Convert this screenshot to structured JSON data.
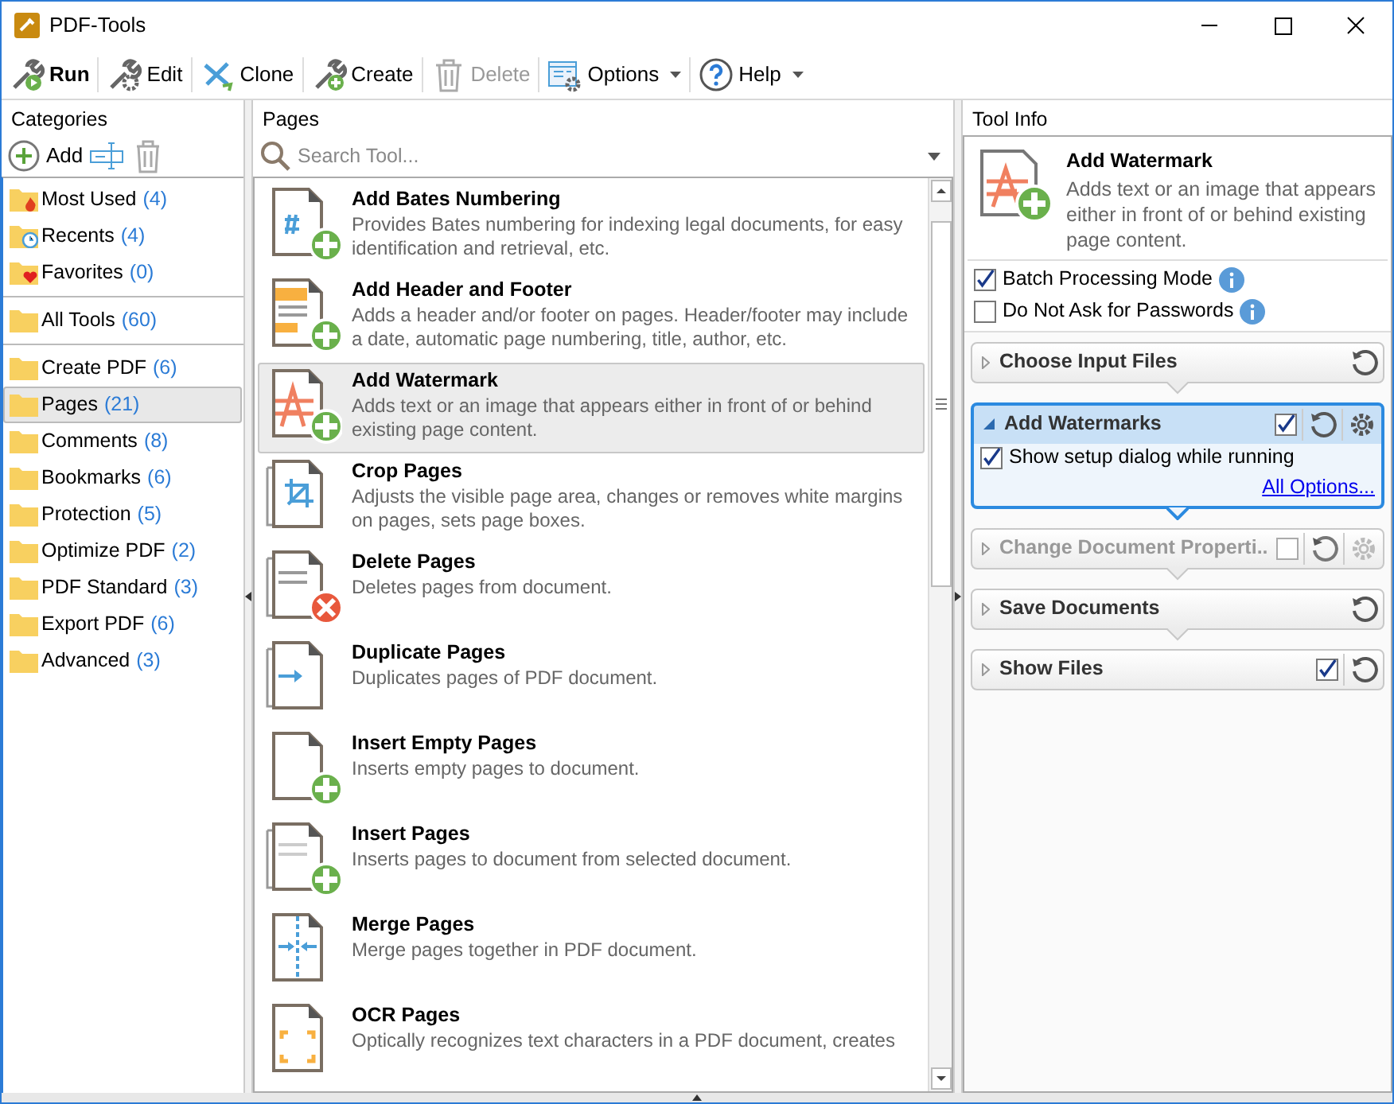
{
  "window": {
    "title": "PDF-Tools"
  },
  "toolbar": [
    {
      "label": "Run",
      "default": true,
      "disabled": false,
      "dropdown": false
    },
    {
      "label": "Edit",
      "default": false,
      "disabled": false,
      "dropdown": false
    },
    {
      "label": "Clone",
      "default": false,
      "disabled": false,
      "dropdown": false
    },
    {
      "label": "Create",
      "default": false,
      "disabled": false,
      "dropdown": false
    },
    {
      "label": "Delete",
      "default": false,
      "disabled": true,
      "dropdown": false
    },
    {
      "label": "Options",
      "default": false,
      "disabled": false,
      "dropdown": true
    },
    {
      "label": "Help",
      "default": false,
      "disabled": false,
      "dropdown": true
    }
  ],
  "categories": {
    "title": "Categories",
    "add_label": "Add",
    "groups": [
      [
        {
          "name": "Most Used",
          "count": "(4)",
          "selected": false
        },
        {
          "name": "Recents",
          "count": "(4)",
          "selected": false
        },
        {
          "name": "Favorites",
          "count": "(0)",
          "selected": false
        }
      ],
      [
        {
          "name": "All Tools",
          "count": "(60)",
          "selected": false
        }
      ],
      [
        {
          "name": "Create PDF",
          "count": "(6)",
          "selected": false
        },
        {
          "name": "Pages",
          "count": "(21)",
          "selected": true
        },
        {
          "name": "Comments",
          "count": "(8)",
          "selected": false
        },
        {
          "name": "Bookmarks",
          "count": "(6)",
          "selected": false
        },
        {
          "name": "Protection",
          "count": "(5)",
          "selected": false
        },
        {
          "name": "Optimize PDF",
          "count": "(2)",
          "selected": false
        },
        {
          "name": "PDF Standard",
          "count": "(3)",
          "selected": false
        },
        {
          "name": "Export PDF",
          "count": "(6)",
          "selected": false
        },
        {
          "name": "Advanced",
          "count": "(3)",
          "selected": false
        }
      ]
    ]
  },
  "pages": {
    "title": "Pages",
    "search": {
      "placeholder": "Search Tool..."
    },
    "tools": [
      {
        "name": "Add Bates Numbering",
        "description": "Provides Bates numbering for indexing legal documents, for easy identification and retrieval, etc.",
        "selected": false
      },
      {
        "name": "Add Header and Footer",
        "description": "Adds a header and/or footer on pages. Header/footer may include a date, automatic page numbering, title, author, etc.",
        "selected": false
      },
      {
        "name": "Add Watermark",
        "description": "Adds text or an image that appears either in front of or behind existing page content.",
        "selected": true
      },
      {
        "name": "Crop Pages",
        "description": "Adjusts the visible page area, changes or removes white margins on pages, sets page boxes.",
        "selected": false
      },
      {
        "name": "Delete Pages",
        "description": "Deletes pages from document.",
        "selected": false
      },
      {
        "name": "Duplicate Pages",
        "description": "Duplicates pages of PDF document.",
        "selected": false
      },
      {
        "name": "Insert Empty Pages",
        "description": "Inserts empty pages to document.",
        "selected": false
      },
      {
        "name": "Insert Pages",
        "description": "Inserts pages to document from selected document.",
        "selected": false
      },
      {
        "name": "Merge Pages",
        "description": "Merge pages together in PDF document.",
        "selected": false
      },
      {
        "name": "OCR Pages",
        "description": "Optically recognizes text characters in a PDF document, creates",
        "selected": false
      }
    ]
  },
  "tool_info": {
    "title": "Tool Info",
    "name": "Add Watermark",
    "description": "Adds text or an image that appears either in front of or behind existing page content.",
    "options": [
      {
        "label": "Batch Processing Mode",
        "checked": true
      },
      {
        "label": "Do Not Ask for Passwords",
        "checked": false
      }
    ],
    "steps": [
      {
        "title": "Choose Input Files",
        "expanded": false,
        "disabled": false,
        "settings": false
      },
      {
        "title": "Add Watermarks",
        "expanded": true,
        "disabled": false,
        "checked": true,
        "settings": true,
        "option": {
          "label": "Show setup dialog while running",
          "checked": true
        },
        "link": "All Options..."
      },
      {
        "title": "Change Document Properti..",
        "expanded": false,
        "disabled": true,
        "checked": false,
        "settings": true
      },
      {
        "title": "Save Documents",
        "expanded": false,
        "disabled": false,
        "settings": false
      },
      {
        "title": "Show Files",
        "expanded": false,
        "disabled": false,
        "checked": true,
        "settings": false
      }
    ]
  }
}
